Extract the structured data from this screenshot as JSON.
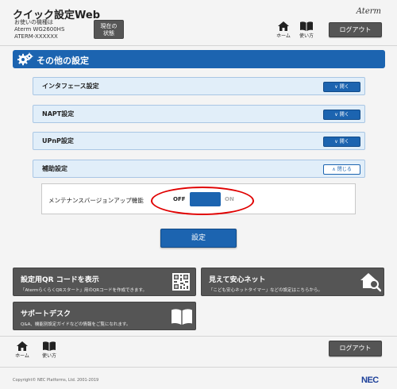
{
  "header": {
    "title": "クイック設定Web",
    "model_lines": [
      "お使いの機種は",
      "Aterm WG2600HS",
      "ATERM-XXXXXX"
    ],
    "status_button": [
      "現在の",
      "状態"
    ],
    "brand": "Aterm",
    "home_label": "ホーム",
    "guide_label": "使い方",
    "logout_label": "ログアウト"
  },
  "section": {
    "title": "その他の設定"
  },
  "accordion": [
    {
      "label": "インタフェース設定",
      "button": "開く",
      "state": "collapsed"
    },
    {
      "label": "NAPT設定",
      "button": "開く",
      "state": "collapsed"
    },
    {
      "label": "UPnP設定",
      "button": "開く",
      "state": "collapsed"
    },
    {
      "label": "補助設定",
      "button": "閉じる",
      "state": "expanded"
    }
  ],
  "maintenance": {
    "label": "メンテナンスバージョンアップ機能",
    "off_label": "OFF",
    "on_label": "ON",
    "value": "OFF"
  },
  "submit_label": "設定",
  "cards": [
    {
      "title": "設定用QR コードを表示",
      "desc": "「AtermらくらくQRスタート」用のQRコードを作成できます。",
      "icon": "qr-code-icon"
    },
    {
      "title": "見えて安心ネット",
      "desc": "「こども安心ネットタイマー」などの設定はこちらから。",
      "icon": "house-search-icon"
    },
    {
      "title": "サポートデスク",
      "desc": "Q&A、機能別設定ガイドなどの情報をご覧になれます。",
      "icon": "book-icon"
    }
  ],
  "footer": {
    "home_label": "ホーム",
    "guide_label": "使い方",
    "logout_label": "ログアウト",
    "copyright": "Copyright© NEC Platforms, Ltd. 2001-2019",
    "logo": "NEC"
  },
  "colors": {
    "accent": "#1c64b0",
    "panel": "#e1eef9",
    "dark_button": "#555555",
    "annotation": "#e00000"
  }
}
